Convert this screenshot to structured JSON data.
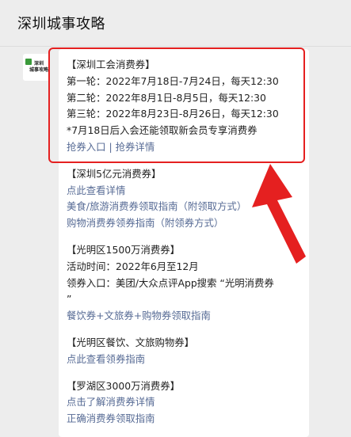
{
  "header": {
    "title": "深圳城事攻略"
  },
  "account": {
    "logo_text_line1": "深圳",
    "logo_text_line2": "城事攻略"
  },
  "sections": [
    {
      "title": "【深圳工会消费券】",
      "lines": [
        "第一轮：2022年7月18日-7月24日，每天12:30",
        "第二轮：2022年8月1日-8月5日，每天12:30",
        "第三轮：2022年8月23日-8月26日，每天12:30",
        "*7月18日后入会还能领取新会员专享消费券"
      ],
      "links": [
        "抢券入口",
        "|",
        "抢券详情"
      ]
    },
    {
      "title": "【深圳5亿元消费券】",
      "link_lines": [
        "点此查看详情",
        "美食/旅游消费券领取指南（附领取方式）",
        "购物消费券领券指南（附领券方式）"
      ]
    },
    {
      "title": "【光明区1500万消费券】",
      "lines": [
        "活动时间：2022年6月至12月",
        "领券入口：美团/大众点评App搜索 “光明消费券",
        "”"
      ],
      "link_lines": [
        "餐饮券+文旅券+购物券领取指南"
      ]
    },
    {
      "title": "【光明区餐饮、文旅购物券】",
      "link_lines": [
        "点此查看领券指南"
      ]
    },
    {
      "title": "【罗湖区3000万消费券】",
      "link_lines": [
        "点击了解消费券详情",
        "正确消费券领取指南"
      ]
    }
  ],
  "colors": {
    "highlight": "#e52020",
    "link": "#576b95",
    "background": "#ededed"
  }
}
